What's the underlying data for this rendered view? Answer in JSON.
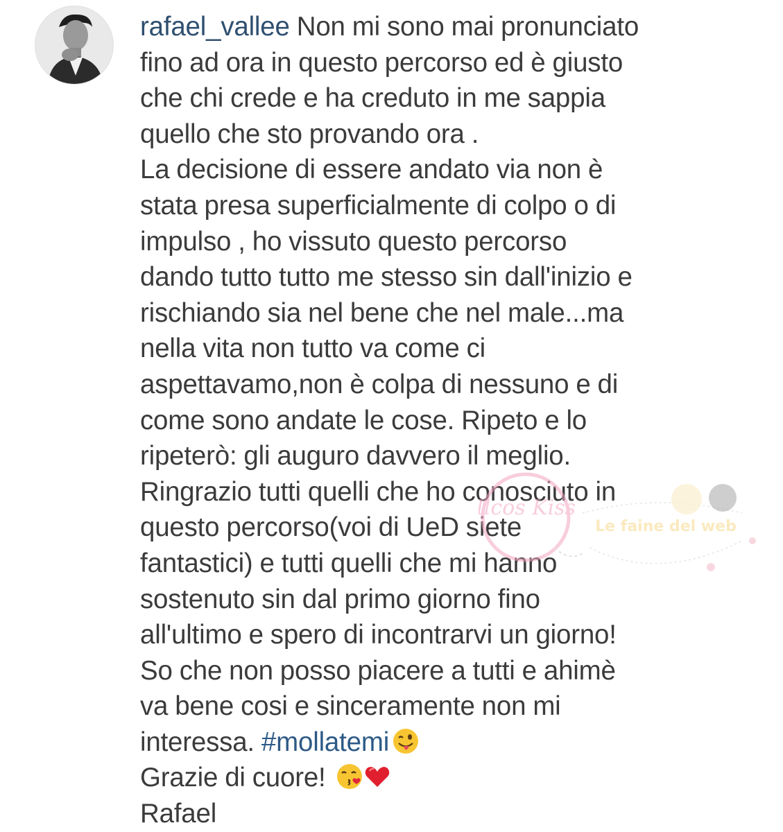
{
  "post": {
    "username": "rafael_vallee",
    "lines": [
      " Non mi sono mai pronunciato",
      "fino ad ora in questo percorso ed è giusto",
      "che chi crede e ha creduto in me sappia",
      "quello che sto provando ora .",
      "La decisione di essere andato via non è",
      "stata presa superficialmente di colpo o di",
      "impulso , ho vissuto questo percorso",
      "dando tutto tutto me stesso sin dall'inizio e",
      "rischiando sia nel bene che nel male...ma",
      "nella vita non tutto va come ci",
      "aspettavamo,non è colpa di nessuno e di",
      "come sono andate le cose. Ripeto e lo",
      "ripeterò: gli auguro davvero il meglio.",
      "Ringrazio tutti quelli che ho conosciuto in",
      "questo percorso(voi di UeD siete",
      "fantastici) e tutti quelli che mi hanno",
      "sostenuto sin dal primo giorno fino",
      "all'ultimo e spero di incontrarvi un giorno!",
      "So che non posso piacere a tutti e ahimè",
      "va bene cosi e sinceramente non mi"
    ],
    "interessa_text": "interessa. ",
    "hashtag": "#mollatemi",
    "thanks_text": "Grazie di cuore! ",
    "signature": "Rafael",
    "emojis": [
      "winking-tongue-emoji",
      "kissing-emoji",
      "red-heart-emoji"
    ]
  },
  "watermark": {
    "circle_text": "Ilcos Kiss",
    "banner_text": "Le faine del web"
  },
  "colors": {
    "text": "#3b3b3b",
    "username": "#2f4f6f",
    "hashtag": "#2d5a86",
    "background": "#ffffff"
  }
}
